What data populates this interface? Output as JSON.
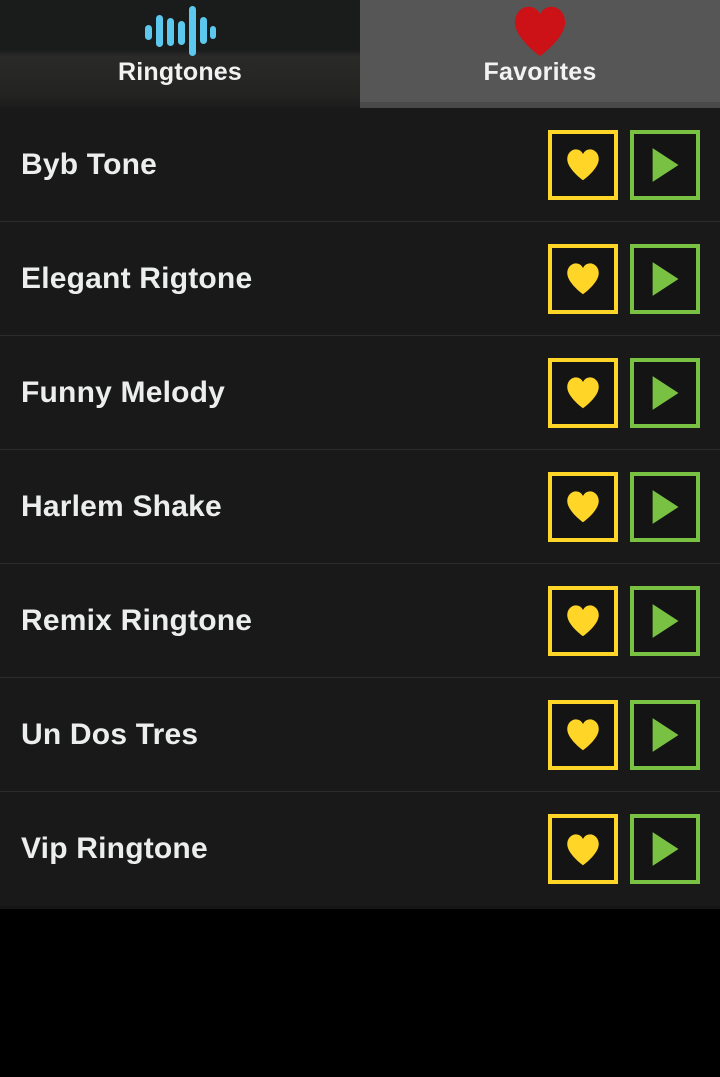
{
  "app": {
    "background": "#000000",
    "list_background": "#191919",
    "separator_color": "#2c2c2c"
  },
  "tabs": [
    {
      "label": "Ringtones",
      "icon": "waveform-icon",
      "icon_color": "#5cc8ee",
      "selected": true
    },
    {
      "label": "Favorites",
      "icon": "heart-icon",
      "icon_color": "#cc1117",
      "selected": false
    }
  ],
  "colors": {
    "favorite_border": "#ffd528",
    "favorite_fill": "#ffd528",
    "play_border": "#78c142",
    "play_fill": "#78c142",
    "tab_selected_bg": "#191c1b",
    "tab_unselected_bg": "#565656",
    "row_text": "#eceded"
  },
  "actions": {
    "favorite_label": "favorite-button",
    "play_label": "play-button"
  },
  "ringtones": [
    {
      "title": "Byb Tone"
    },
    {
      "title": "Elegant Rigtone"
    },
    {
      "title": "Funny Melody"
    },
    {
      "title": "Harlem Shake"
    },
    {
      "title": "Remix Ringtone"
    },
    {
      "title": "Un Dos Tres"
    },
    {
      "title": "Vip Ringtone"
    }
  ]
}
